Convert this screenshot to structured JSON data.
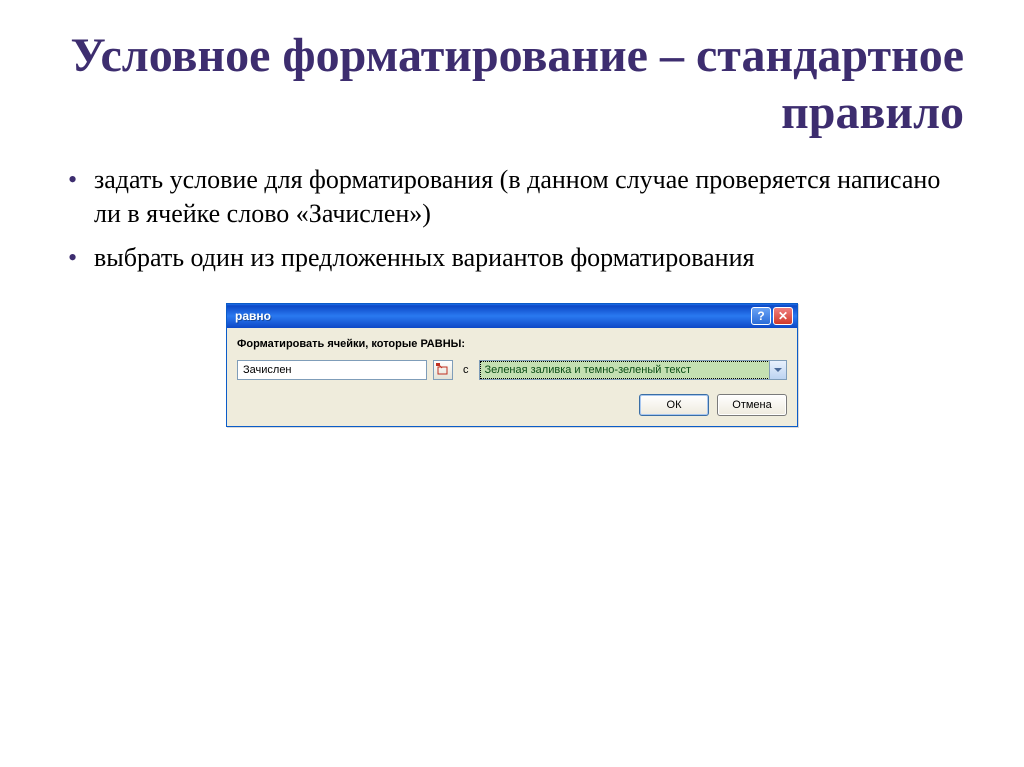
{
  "title": "Условное форматирование – стандартное правило",
  "bullets": [
    "задать условие для форматирования (в данном случае проверяется написано ли в ячейке слово «Зачислен»)",
    "выбрать один из предложенных вариантов форматирования"
  ],
  "dialog": {
    "caption": "равно",
    "label": "Форматировать ячейки, которые РАВНЫ:",
    "input_value": "Зачислен",
    "c_label": "с",
    "combo_value": "Зеленая заливка и темно-зеленый текст",
    "ok": "ОК",
    "cancel": "Отмена"
  }
}
